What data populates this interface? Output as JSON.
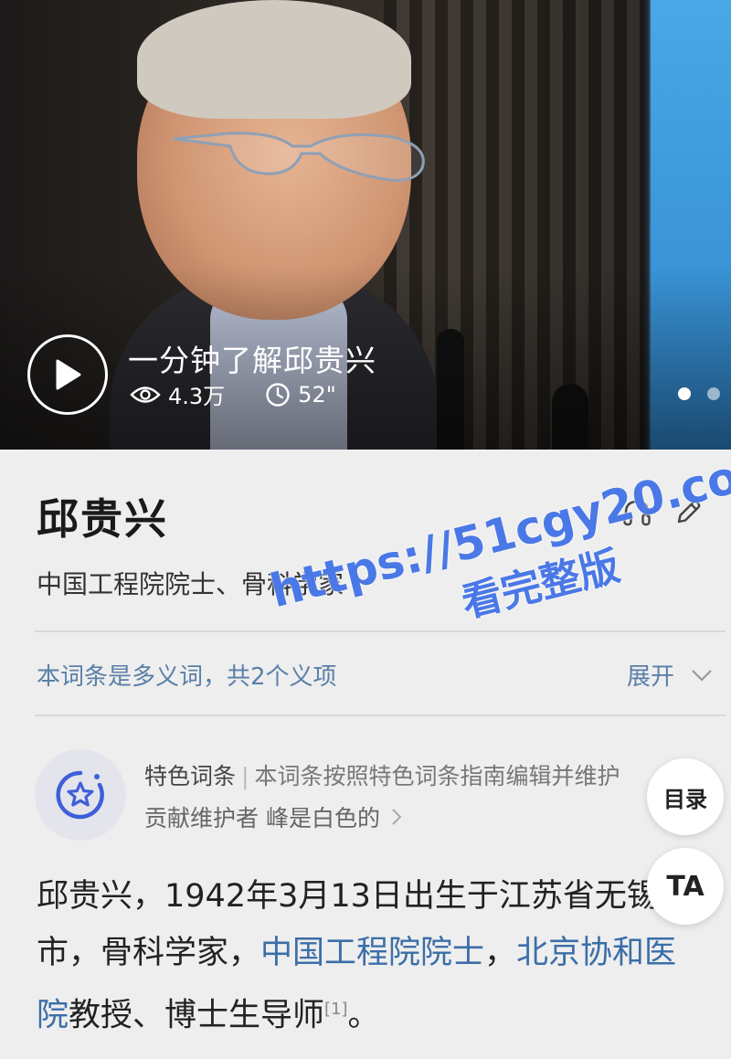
{
  "video": {
    "title": "一分钟了解邱贵兴",
    "views": "4.3万",
    "duration": "52\"",
    "play_icon": "play-icon",
    "views_icon": "eye-icon",
    "duration_icon": "clock-icon",
    "slide_count": 2,
    "active_slide": 1
  },
  "entry": {
    "title": "邱贵兴",
    "listen_icon": "headphones-icon",
    "edit_icon": "pencil-icon",
    "subtitle": "中国工程院院士、骨科学家"
  },
  "polysemy": {
    "text": "本词条是多义词，共2个义项",
    "expand_label": "展开"
  },
  "featured": {
    "badge_icon": "star-badge-icon",
    "label": "特色词条",
    "separator": "|",
    "description": "本词条按照特色词条指南编辑并维护",
    "contributor_prefix": "贡献维护者",
    "contributor_name": "峰是白色的"
  },
  "floating": {
    "toc_label": "目录",
    "ta_label": "TA"
  },
  "body": {
    "part1": "邱贵兴，1942年3月13日出生于江苏省无锡市，骨科学家，",
    "link1": "中国工程院院士",
    "comma": "，",
    "link2": "北京协和医院",
    "part2": "教授、博士生导师",
    "ref": "[1]",
    "end": "。"
  },
  "watermark": {
    "url": "https://51cgy20.com",
    "tagline": "看完整版"
  },
  "colors": {
    "link": "#3b6ea8",
    "polysemy": "#5a7fa8",
    "watermark": "#4a78e6",
    "background": "#eeeeee"
  }
}
